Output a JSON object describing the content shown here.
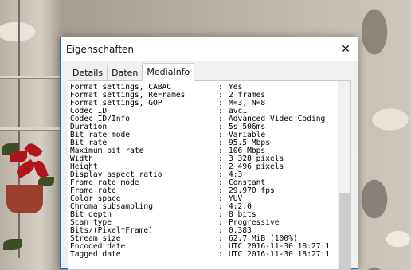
{
  "window": {
    "title": "Eigenschaften",
    "close_glyph": "✕"
  },
  "tabs": [
    {
      "label": "Details",
      "active": false
    },
    {
      "label": "Daten",
      "active": false
    },
    {
      "label": "MediaInfo",
      "active": true
    }
  ],
  "mediainfo": [
    {
      "key": "Format settings, CABAC",
      "value": "Yes"
    },
    {
      "key": "Format settings, ReFrames",
      "value": "2 frames"
    },
    {
      "key": "Format settings, GOP",
      "value": "M=3, N=8"
    },
    {
      "key": "Codec ID",
      "value": "avc1"
    },
    {
      "key": "Codec ID/Info",
      "value": "Advanced Video Coding"
    },
    {
      "key": "Duration",
      "value": "5s 506ms"
    },
    {
      "key": "Bit rate mode",
      "value": "Variable"
    },
    {
      "key": "Bit rate",
      "value": "95.5 Mbps"
    },
    {
      "key": "Maximum bit rate",
      "value": "106 Mbps"
    },
    {
      "key": "Width",
      "value": "3 328 pixels"
    },
    {
      "key": "Height",
      "value": "2 496 pixels"
    },
    {
      "key": "Display aspect ratio",
      "value": "4:3"
    },
    {
      "key": "Frame rate mode",
      "value": "Constant"
    },
    {
      "key": "Frame rate",
      "value": "29.970 fps"
    },
    {
      "key": "Color space",
      "value": "YUV"
    },
    {
      "key": "Chroma subsampling",
      "value": "4:2:0"
    },
    {
      "key": "Bit depth",
      "value": "8 bits"
    },
    {
      "key": "Scan type",
      "value": "Progressive"
    },
    {
      "key": "Bits/(Pixel*Frame)",
      "value": "0.383"
    },
    {
      "key": "Stream size",
      "value": "62.7 MiB (100%)"
    },
    {
      "key": "Encoded date",
      "value": "UTC 2016-11-30 18:27:1"
    },
    {
      "key": "Tagged date",
      "value": "UTC 2016-11-30 18:27:1"
    }
  ],
  "separator": ":",
  "colors": {
    "window_border": "#1a6fc9",
    "window_bg": "#f0f0f0",
    "panel_bg": "#ffffff"
  }
}
